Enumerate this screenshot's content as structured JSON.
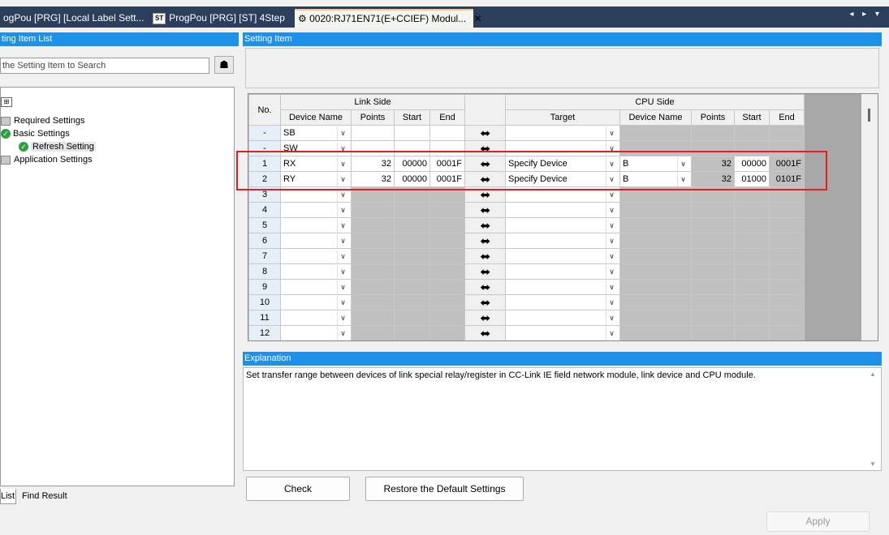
{
  "tabs": [
    {
      "label": "ogPou [PRG] [Local Label Sett...",
      "active": false
    },
    {
      "icon_text": "ST",
      "label": "ProgPou [PRG] [ST] 4Step",
      "active": false
    },
    {
      "label": "0020:RJ71EN71(E+CCIEF) Modul...",
      "active": true,
      "close": "✕"
    }
  ],
  "tab_nav": "◂ ▸ ▾",
  "left_panel": {
    "header": "ting Item List",
    "search_placeholder": "the Setting Item to Search",
    "search_icon": "binoculars-icon",
    "tree": [
      {
        "label": "Required Settings"
      },
      {
        "label": "Basic Settings"
      },
      {
        "label": "Refresh Setting"
      },
      {
        "label": "Application Settings"
      }
    ],
    "bottom_tabs": [
      "List",
      "Find Result"
    ]
  },
  "right_panel": {
    "header": "Setting Item",
    "grid": {
      "headers": {
        "no": "No.",
        "link_side": "Link Side",
        "cpu_side": "CPU Side",
        "device_name": "Device Name",
        "points": "Points",
        "start": "Start",
        "end": "End",
        "target": "Target"
      },
      "rows": [
        {
          "no": "-",
          "link_dev": "SB",
          "link_points": "",
          "link_start": "",
          "link_end": "",
          "target": "",
          "cpu_dev": "",
          "cpu_points": "",
          "cpu_start": "",
          "cpu_end": ""
        },
        {
          "no": "-",
          "link_dev": "SW",
          "link_points": "",
          "link_start": "",
          "link_end": "",
          "target": "",
          "cpu_dev": "",
          "cpu_points": "",
          "cpu_start": "",
          "cpu_end": ""
        },
        {
          "no": "1",
          "link_dev": "RX",
          "link_points": "32",
          "link_start": "00000",
          "link_end": "0001F",
          "target": "Specify Device",
          "cpu_dev": "B",
          "cpu_points": "32",
          "cpu_start": "00000",
          "cpu_end": "0001F"
        },
        {
          "no": "2",
          "link_dev": "RY",
          "link_points": "32",
          "link_start": "00000",
          "link_end": "0001F",
          "target": "Specify Device",
          "cpu_dev": "B",
          "cpu_points": "32",
          "cpu_start": "01000",
          "cpu_end": "0101F"
        },
        {
          "no": "3"
        },
        {
          "no": "4"
        },
        {
          "no": "5"
        },
        {
          "no": "6"
        },
        {
          "no": "7"
        },
        {
          "no": "8"
        },
        {
          "no": "9"
        },
        {
          "no": "10"
        },
        {
          "no": "11"
        },
        {
          "no": "12"
        }
      ]
    },
    "explanation_header": "Explanation",
    "explanation_text": "Set transfer range between devices of link special relay/register in CC-Link IE field network module, link device and CPU module.",
    "buttons": {
      "check": "Check",
      "restore": "Restore the Default Settings",
      "apply": "Apply"
    }
  },
  "colors": {
    "accent_header": "#1e90e8",
    "tabbar": "#2b3f5c",
    "highlight": "#e02020",
    "status_ok": "#2ea043"
  }
}
